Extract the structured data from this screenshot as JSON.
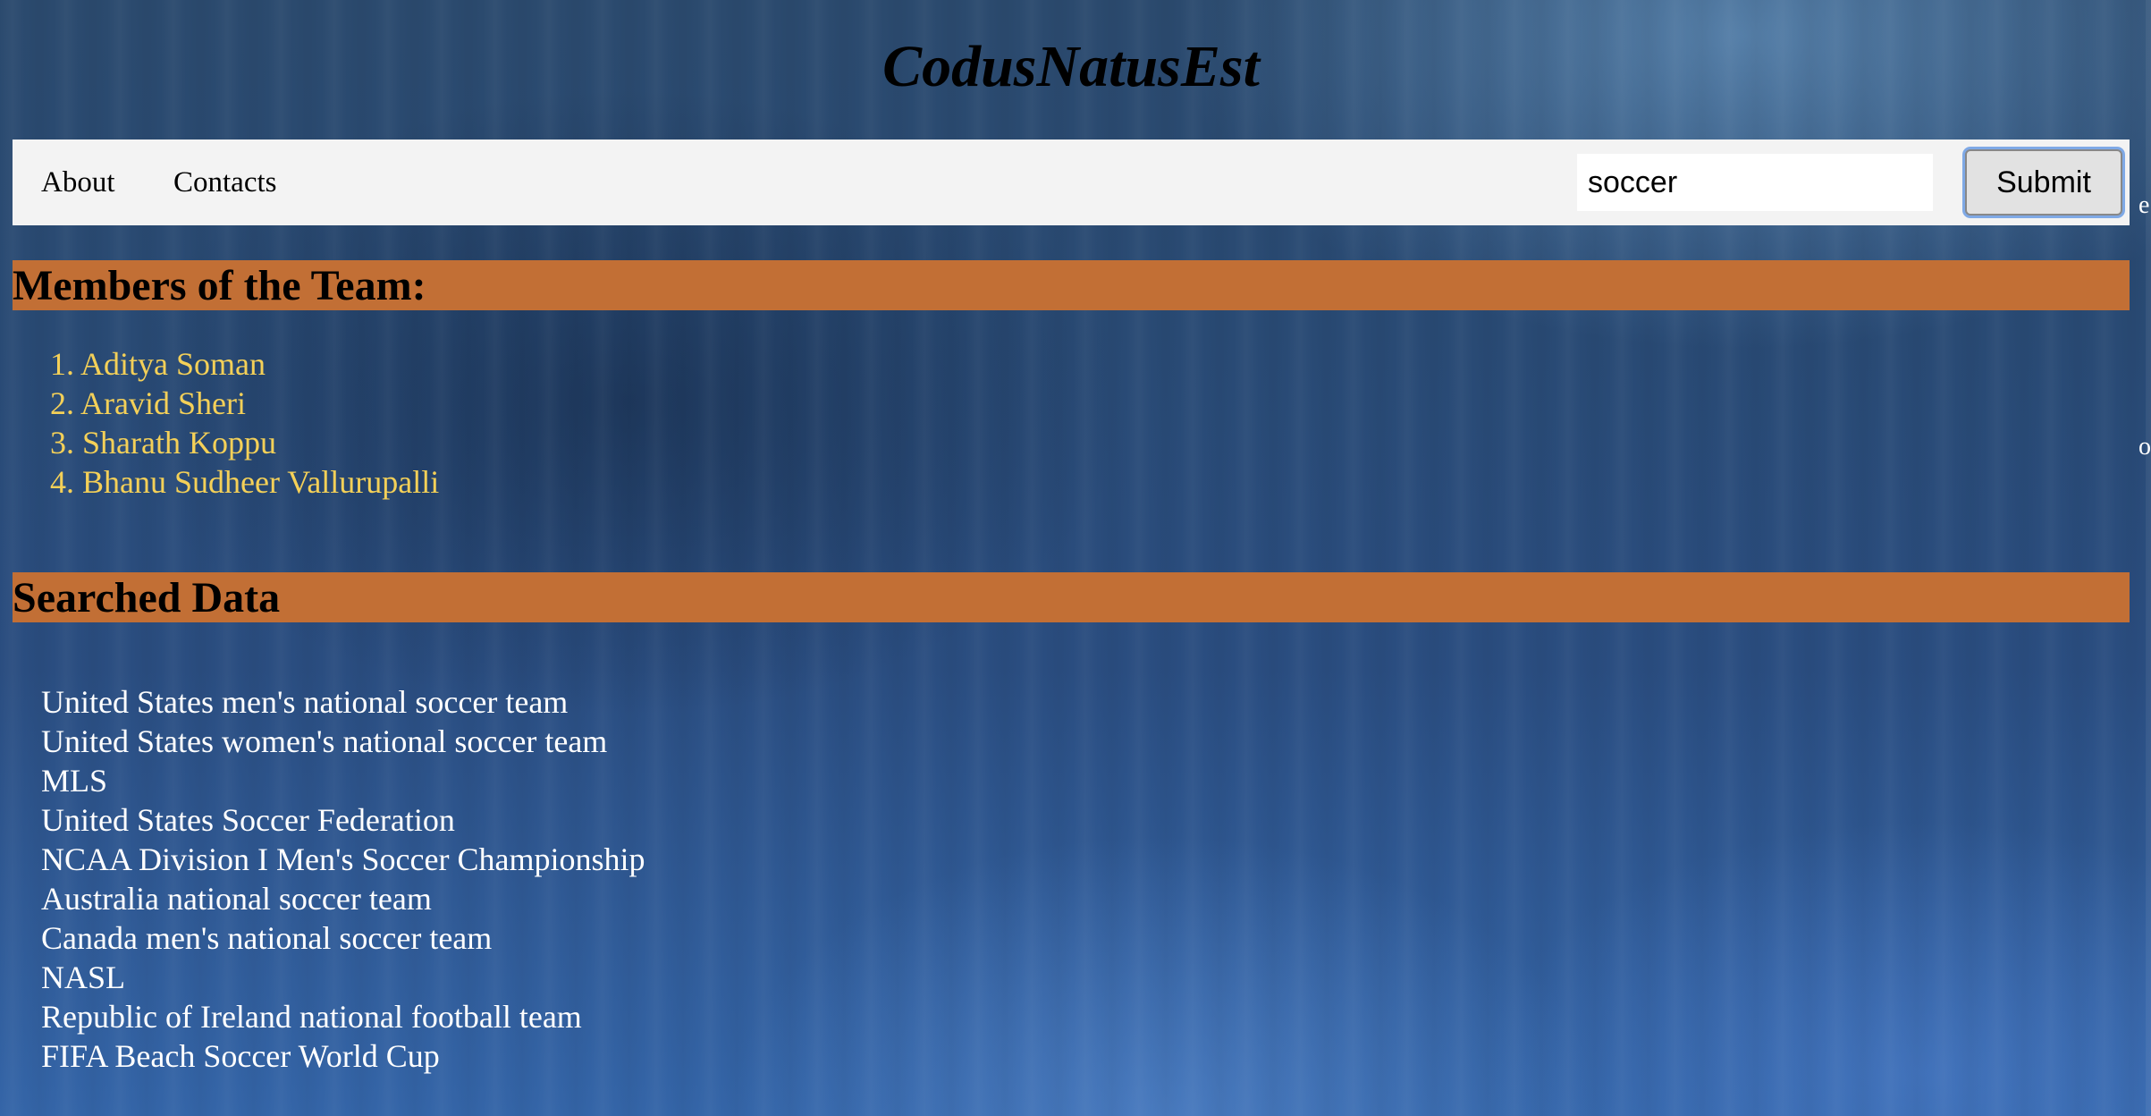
{
  "site": {
    "title": "CodusNatusEst"
  },
  "nav": {
    "about": "About",
    "contacts": "Contacts"
  },
  "search": {
    "value": "soccer",
    "submit_label": "Submit"
  },
  "members": {
    "heading": "Members of the Team:",
    "items": [
      "Aditya Soman",
      "Aravid Sheri",
      "Sharath Koppu",
      "Bhanu Sudheer Vallurupalli"
    ]
  },
  "results": {
    "heading": "Searched Data",
    "items": [
      "United States men's national soccer team",
      "United States women's national soccer team",
      "MLS",
      "United States Soccer Federation",
      "NCAA Division I Men's Soccer Championship",
      "Australia national soccer team",
      "Canada men's national soccer team",
      "NASL",
      "Republic of Ireland national football team",
      "FIFA Beach Soccer World Cup"
    ]
  },
  "edge_fragments": [
    "e",
    "o"
  ],
  "colors": {
    "heading_band": "#c26f35",
    "member_text": "#f4d058",
    "navbar_bg": "#f3f3f3",
    "focus_ring": "#7fa9e6"
  }
}
